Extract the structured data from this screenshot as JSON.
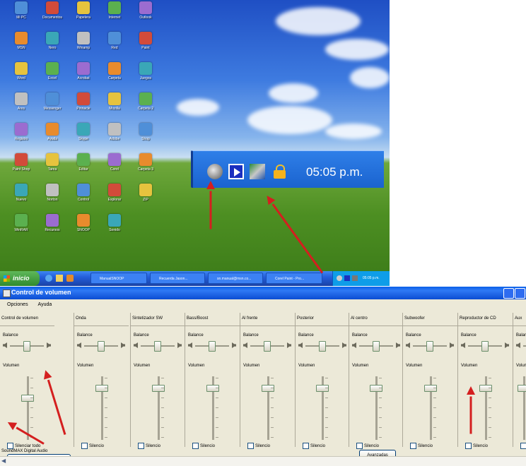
{
  "tray_zoom": {
    "clock": "05:05 p.m."
  },
  "taskbar": {
    "start_label": "inicio",
    "buttons": [
      "ManualSNOOP",
      "Recuerda Jason...",
      "sn.manual@msn.co...",
      "Corel Paint - Pro..."
    ],
    "tray_clock": "05:05 p.m."
  },
  "desktop_icons": [
    "Mi PC",
    "Documentos",
    "Papelera",
    "Internet",
    "Outlook",
    "MSN",
    "Nero",
    "Winamp",
    "Red",
    "Paint",
    "Word",
    "Excel",
    "Acrobat",
    "Carpeta",
    "Juegos",
    "Ares",
    "Messenger",
    "Pinnacle",
    "Mozilla",
    "Carpeta 2",
    "Registro",
    "Ayuda",
    "Skype",
    "Adobe",
    "Shop",
    "Paint Shop",
    "Tarea",
    "Editar",
    "Corel",
    "Carpeta 3",
    "Nuevo",
    "Norton",
    "Control",
    "Explorar",
    "ZIP",
    "WinRAR",
    "Recursos",
    "SNOOP",
    "Sonido"
  ],
  "volume_window": {
    "title": "Control de volumen",
    "menu": [
      "Opciones",
      "Ayuda"
    ],
    "balance_label": "Balance",
    "volume_label": "Volumen",
    "advanced_label": "Avanzadas",
    "channels": [
      {
        "name": "Control de volumen",
        "mute": "Silenciar todo",
        "advanced": true
      },
      {
        "name": "Onda",
        "mute": "Silencio"
      },
      {
        "name": "Sintetizador SW",
        "mute": "Silencio"
      },
      {
        "name": "Bass/Boost",
        "mute": "Silencio"
      },
      {
        "name": "Al frente",
        "mute": "Silencio"
      },
      {
        "name": "Posterior",
        "mute": "Silencio"
      },
      {
        "name": "Al centro",
        "mute": "Silencio",
        "advanced": true
      },
      {
        "name": "Subwoofer",
        "mute": "Silencio"
      },
      {
        "name": "Reproductor de CD",
        "mute": "Silencio"
      },
      {
        "name": "Aux",
        "mute": "Silencio"
      }
    ],
    "status": "SoundMAX Digital Audio"
  },
  "colors": {
    "annotation_arrow": "#d41f1f",
    "title_bar": "#0a5fe8",
    "window_face": "#ece9d8"
  }
}
